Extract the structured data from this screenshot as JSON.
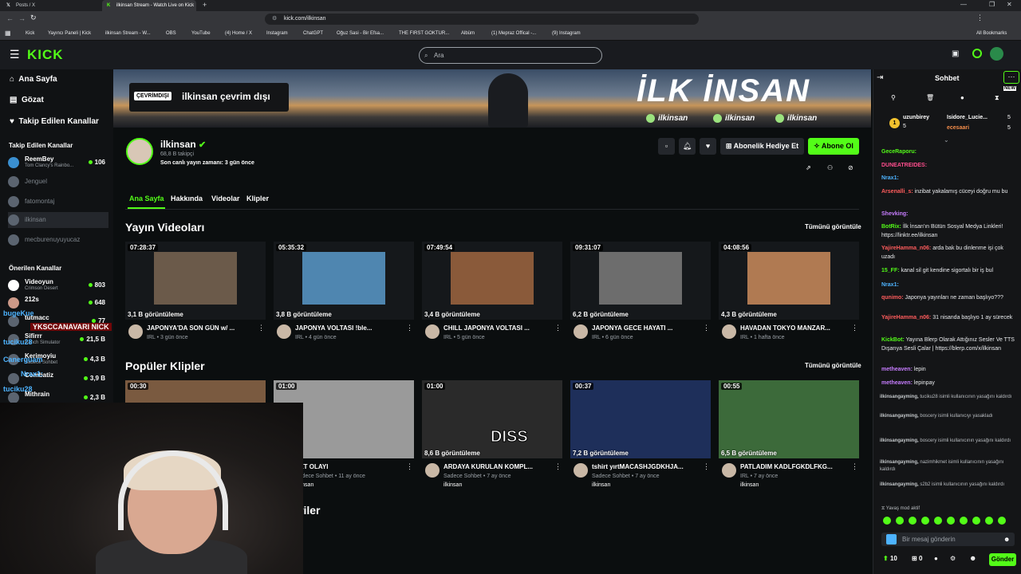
{
  "browser": {
    "tabs": [
      {
        "label": "Posts / X"
      },
      {
        "label": "ilkinsan Stream - Watch Live on Kick"
      }
    ],
    "url": "kick.com/ilkinsan",
    "bookmarks": [
      "Kick",
      "Yayıncı Paneli | Kick",
      "ilkinsan Stream - W...",
      "OBS",
      "YouTube",
      "(4) Home / X",
      "Instagram",
      "ChatGPT",
      "Oğuz Sasi - Bir Efsa...",
      "THE FIRST GOKTUR...",
      "Albüm",
      "(1) Mepraz Offical -...",
      "(9) Instagram"
    ],
    "all_bookmarks": "All Bookmarks"
  },
  "topnav": {
    "logo": "KICK",
    "search_placeholder": "Ara"
  },
  "sidebar": {
    "nav": [
      {
        "label": "Ana Sayfa"
      },
      {
        "label": "Gözat"
      },
      {
        "label": "Takip Edilen Kanallar"
      }
    ],
    "followed_header": "Takip Edilen Kanallar",
    "followed": [
      {
        "name": "ReemBey",
        "game": "Tom Clancy's Rainbo...",
        "viewers": "106"
      },
      {
        "name": "Jenguel"
      },
      {
        "name": "fatomontaj"
      },
      {
        "name": "ilkinsan"
      },
      {
        "name": "mecburenuyuyucaz"
      }
    ],
    "recommended_header": "Önerilen Kanallar",
    "recommended": [
      {
        "name": "Videoyun",
        "game": "Crimson Desert",
        "viewers": "803"
      },
      {
        "name": "212s",
        "game": "",
        "viewers": "648"
      },
      {
        "name": "tutmacc",
        "game": "",
        "viewers": "77"
      },
      {
        "name": "Sifirrr",
        "game": "Ranch Simulator",
        "viewers": "21,5 B"
      },
      {
        "name": "Kerimoyiu",
        "game": "Sadece Sohbet",
        "viewers": "4,3 B"
      },
      {
        "name": "Combatiz",
        "game": "",
        "viewers": "3,9 B"
      },
      {
        "name": "Mithrain",
        "game": "",
        "viewers": "2,3 B"
      }
    ]
  },
  "banner": {
    "offline_tag": "ÇEVRİMDIŞI",
    "offline_text": "ilkinsan çevrim dışı",
    "title": "İLK İNSAN",
    "tags": [
      "ilkinsan",
      "ilkinsan",
      "ilkinsan"
    ]
  },
  "profile": {
    "name": "ilkinsan",
    "followers": "68,8 B takipçi",
    "last_live": "Son canlı yayın zamanı: 3 gün önce",
    "gift_btn": "Abonelik Hediye Et",
    "sub_btn": "Abone Ol",
    "tabs": [
      "Ana Sayfa",
      "Hakkında",
      "Videolar",
      "Klipler"
    ]
  },
  "videos": {
    "heading": "Yayın Videoları",
    "see_all": "Tümünü görüntüle",
    "items": [
      {
        "duration": "07:28:37",
        "views": "3,1 B görüntüleme",
        "title": "JAPONYA'DA SON GÜN w/ ...",
        "category": "IRL",
        "age": "3 gün önce",
        "color": "#6b5a4a"
      },
      {
        "duration": "05:35:32",
        "views": "3,8 B görüntüleme",
        "title": "JAPONYA VOLTASI !ble...",
        "category": "IRL",
        "age": "4 gün önce",
        "color": "#4f86b0"
      },
      {
        "duration": "07:49:54",
        "views": "3,4 B görüntüleme",
        "title": "CHILL JAPONYA VOLTASI ...",
        "category": "IRL",
        "age": "5 gün önce",
        "color": "#8a5a3a"
      },
      {
        "duration": "09:31:07",
        "views": "6,2 B görüntüleme",
        "title": "JAPONYA GECE HAYATI ...",
        "category": "IRL",
        "age": "6 gün önce",
        "color": "#6d6d6d"
      },
      {
        "duration": "04:08:56",
        "views": "4,3 B görüntüleme",
        "title": "HAVADAN TOKYO MANZAR...",
        "category": "IRL",
        "age": "1 hafta önce",
        "color": "#b07a52"
      }
    ]
  },
  "clips": {
    "heading": "Popüler Klipler",
    "see_all": "Tümünü görüntüle",
    "items": [
      {
        "duration": "00:30",
        "views": "",
        "title": "",
        "category": "",
        "age": "",
        "channel": "",
        "color": "#7a5a40"
      },
      {
        "duration": "01:00",
        "views": "",
        "title": "ŞET OLAYI",
        "category": "Sadece Sohbet",
        "age": "11 ay önce",
        "channel": "ilkinsan",
        "color": "#9a9a9a"
      },
      {
        "duration": "01:00",
        "views": "8,6 B görüntüleme",
        "title": "ARDAYA KURULAN KOMPL...",
        "category": "Sadece Sohbet",
        "age": "7 ay önce",
        "channel": "ilkinsan",
        "color": "#2a2a2a",
        "overlay": "DISS"
      },
      {
        "duration": "00:37",
        "views": "7,2 B görüntüleme",
        "title": "tshirt yırtMACASHJGDKHJA...",
        "category": "Sadece Sohbet",
        "age": "7 ay önce",
        "channel": "ilkinsan",
        "color": "#1e2f5a"
      },
      {
        "duration": "00:55",
        "views": "6,5 B görüntüleme",
        "title": "PATLADIM KADLFGKDLFKG...",
        "category": "IRL",
        "age": "7 ay önce",
        "channel": "ilkinsan",
        "color": "#3c6a3a"
      }
    ]
  },
  "partial_heading": "riler",
  "chat": {
    "title": "Sohbet",
    "new_badge": "NEW",
    "top_gifters": [
      {
        "name": "uzunbirey",
        "count": "5"
      },
      {
        "name": "Isidore_Lucie...",
        "count": "5"
      },
      {
        "name": "ecesaari",
        "count": "5"
      }
    ],
    "messages": [
      {
        "user": "GeceRaporu:",
        "text": "",
        "color": "#53fc18"
      },
      {
        "user": "DUNEATREIDES:",
        "text": "",
        "color": "#ff4d8d"
      },
      {
        "user": "Nrax1:",
        "text": "",
        "color": "#4db3ff"
      },
      {
        "user": "Arsenalli_s:",
        "text": "inzibat yakalamış cüceyi doğru mu bu",
        "color": "#ff5c5c"
      },
      {
        "user": "Shevking:",
        "text": "",
        "color": "#c77dff"
      },
      {
        "user": "BotRix:",
        "text": "İlk İnsan'ın Bütün Sosyal Medya Linkleri! https://linktr.ee/ilkinsan",
        "color": "#53fc18"
      },
      {
        "user": "YajireHamma_n06:",
        "text": "arda bak bu dinlenme işi çok uzadı",
        "color": "#ff5c5c"
      },
      {
        "user": "15_FF:",
        "text": "kanal sil git kendine sigortalı bir iş bul",
        "color": "#53fc18"
      },
      {
        "user": "Nrax1:",
        "text": "",
        "color": "#4db3ff"
      },
      {
        "user": "qunimo:",
        "text": "Japonya yayınları ne zaman başlıyo???",
        "color": "#ff5c5c"
      },
      {
        "user": "YajireHamma_n06:",
        "text": "31 nisanda başlıyo 1 ay sürecek",
        "color": "#ff5c5c"
      },
      {
        "user": "KickBot:",
        "text": "Yayına Blerp Olarak Attığınız Sesler Ve TTS Dışarıya Sesli Çalar | https://blerp.com/x/ilkinsan",
        "color": "#53fc18"
      },
      {
        "user": "metheaven:",
        "text": "lepin",
        "color": "#c77dff"
      },
      {
        "user": "metheaven:",
        "text": "lepinpay",
        "color": "#c77dff"
      }
    ],
    "mod_actions": [
      {
        "mod": "ilkinsangayming,",
        "text": "tuciku28 isimli kullanıcının yasağını kaldırdı"
      },
      {
        "mod": "ilkinsangayming,",
        "text": "boscery isimli kullanıcıyı yasakladı"
      },
      {
        "mod": "ilkinsangayming,",
        "text": "boscery isimli kullanıcının yasağını kaldırdı"
      },
      {
        "mod": "ilkinsangayming,",
        "text": "nazimhikmet isimli kullanıcının yasağını kaldırdı"
      },
      {
        "mod": "ilkinsangayming,",
        "text": "s2b2 isimli kullanıcının yasağını kaldırdı"
      }
    ],
    "slow_mode": "Yavaş mod aktif",
    "input_placeholder": "Bir mesaj gönderin",
    "points": "10",
    "points2": "0",
    "send_label": "Gönder"
  },
  "overlay_names": [
    "bugeKue",
    "YKSCCANAVARI NICK",
    "tuciku28",
    "Canerguam",
    "Nrax1:",
    "tuciku28"
  ]
}
